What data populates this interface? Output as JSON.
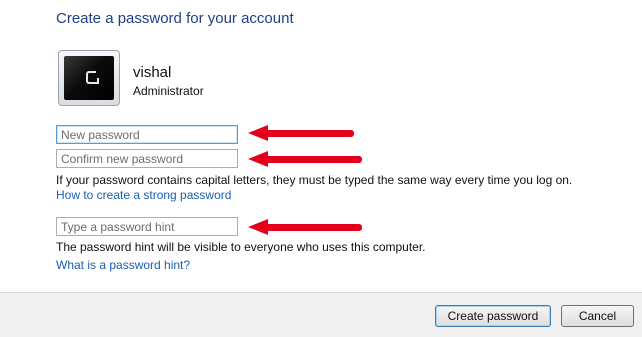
{
  "page": {
    "title": "Create a password for your account"
  },
  "account": {
    "name": "vishal",
    "role": "Administrator",
    "avatar_icon": "user-tile-icon"
  },
  "fields": {
    "new_password_placeholder": "New password",
    "confirm_password_placeholder": "Confirm new password",
    "hint_placeholder": "Type a password hint"
  },
  "text": {
    "caps_warning": "If your password contains capital letters, they must be typed the same way every time you log on.",
    "hint_warning": "The password hint will be visible to everyone who uses this computer."
  },
  "links": {
    "strong_password": "How to create a strong password",
    "password_hint": "What is a password hint?"
  },
  "buttons": {
    "create": "Create password",
    "cancel": "Cancel"
  },
  "colors": {
    "title": "#1e3f8a",
    "link": "#1a5fb4",
    "arrow": "#e3001b"
  }
}
